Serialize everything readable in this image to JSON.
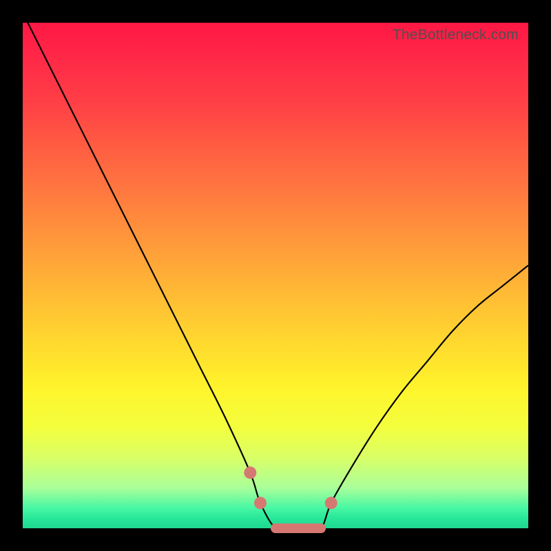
{
  "watermark": "TheBottleneck.com",
  "colors": {
    "frame": "#000000",
    "gradient_top": "#ff1846",
    "gradient_mid": "#fff32b",
    "gradient_bottom": "#1fd890",
    "curve": "#000000",
    "marker": "#d67872"
  },
  "chart_data": {
    "type": "line",
    "title": "",
    "xlabel": "",
    "ylabel": "",
    "xlim": [
      0,
      100
    ],
    "ylim": [
      0,
      100
    ],
    "series": [
      {
        "name": "bottleneck-curve",
        "x": [
          0,
          5,
          10,
          15,
          20,
          25,
          30,
          35,
          40,
          45,
          47,
          50,
          53,
          56,
          59,
          61,
          65,
          70,
          75,
          80,
          85,
          90,
          95,
          100
        ],
        "values": [
          102,
          92,
          82,
          72,
          62,
          52,
          42,
          32,
          22,
          11,
          5,
          0,
          0,
          0,
          0,
          5,
          12,
          20,
          27,
          33,
          39,
          44,
          48,
          52
        ]
      }
    ],
    "markers": {
      "name": "highlight-points",
      "x": [
        45,
        47,
        50,
        53,
        56,
        59,
        61
      ],
      "values": [
        11,
        5,
        0,
        0,
        0,
        0,
        5
      ]
    }
  }
}
